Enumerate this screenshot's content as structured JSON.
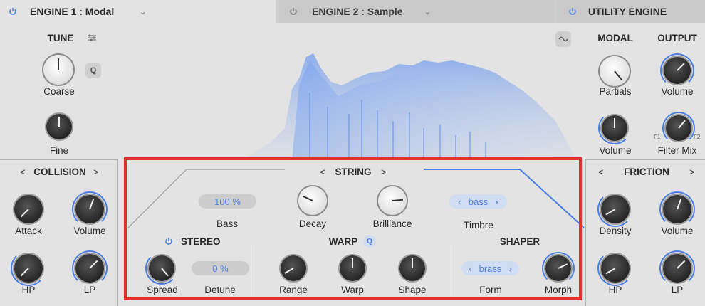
{
  "tabs": {
    "engine1": "ENGINE 1 : Modal",
    "engine2": "ENGINE 2 : Sample",
    "utility": "UTILITY ENGINE"
  },
  "tune": {
    "title": "TUNE",
    "q_label": "Q",
    "coarse_label": "Coarse",
    "fine_label": "Fine"
  },
  "modal": {
    "title": "MODAL",
    "partials_label": "Partials",
    "volume_label": "Volume"
  },
  "output": {
    "title": "OUTPUT",
    "volume_label": "Volume",
    "filter_mix_label": "Filter Mix",
    "f1_label": "F1",
    "f2_label": "F2"
  },
  "collision": {
    "title": "COLLISION",
    "prev": "<",
    "next": ">",
    "attack_label": "Attack",
    "volume_label": "Volume",
    "hp_label": "HP",
    "lp_label": "LP"
  },
  "friction": {
    "title": "FRICTION",
    "prev": "<",
    "next": ">",
    "density_label": "Density",
    "volume_label": "Volume",
    "hp_label": "HP",
    "lp_label": "LP"
  },
  "string": {
    "title": "STRING",
    "prev": "<",
    "next": ">",
    "bass_value": "100 %",
    "bass_label": "Bass",
    "decay_label": "Decay",
    "brilliance_label": "Brilliance",
    "timbre_value": "bass",
    "timbre_label": "Timbre"
  },
  "stereo": {
    "title": "STEREO",
    "spread_label": "Spread",
    "detune_value": "0 %",
    "detune_label": "Detune"
  },
  "warp": {
    "title": "WARP",
    "q_label": "Q",
    "range_label": "Range",
    "warp_label": "Warp",
    "shape_label": "Shape"
  },
  "shaper": {
    "title": "SHAPER",
    "form_value": "brass",
    "form_label": "Form",
    "morph_label": "Morph"
  },
  "colors": {
    "accent": "#4d7fe0",
    "highlight_box": "#e8302a"
  }
}
